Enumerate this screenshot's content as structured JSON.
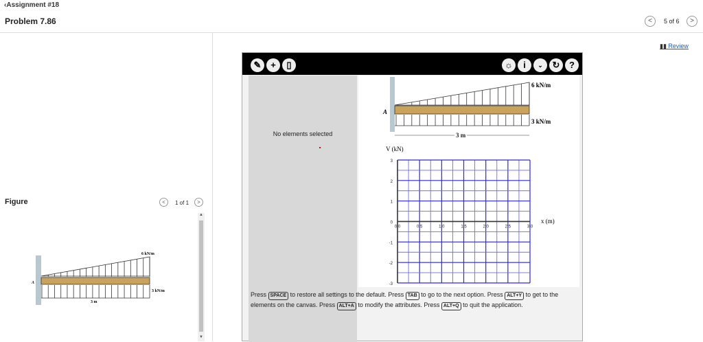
{
  "header": {
    "back_label": "Assignment #18",
    "problem_title": "Problem 7.86",
    "pager": "5 of 6",
    "prev": "<",
    "next": ">"
  },
  "review": {
    "label": "Review"
  },
  "figure": {
    "title": "Figure",
    "pager": "1 of 1",
    "prev": "<",
    "next": ">",
    "load_top": "6 kN/m",
    "load_bottom": "3 kN/m",
    "length": "3 m",
    "support": "A"
  },
  "app": {
    "toolbar_left": [
      "pencil-icon",
      "plus-icon",
      "trash-icon"
    ],
    "toolbar_right": [
      "hint-icon",
      "info-icon",
      "chevron-down-icon",
      "reset-icon",
      "help-icon"
    ],
    "status": "No elements selected",
    "diagram": {
      "load_top": "6 kN/m",
      "load_bottom": "3 kN/m",
      "length": "3 m",
      "support": "A"
    },
    "help": {
      "p1": "Press",
      "k1": "SPACE",
      "p2": "to restore all settings to the default. Press",
      "k2": "TAB",
      "p3": "to go to the next option. Press",
      "k3": "ALT+Y",
      "p4": "to get to the elements on the canvas. Press",
      "k4": "ALT+A",
      "p5": "to modify the attributes. Press",
      "k5": "ALT+Q",
      "p6": "to quit the application."
    }
  },
  "chart_data": {
    "type": "line",
    "title": "",
    "xlabel": "x (m)",
    "ylabel": "V (kN)",
    "xlim": [
      0,
      3
    ],
    "ylim": [
      -3,
      3
    ],
    "xticks": [
      "0.0",
      "0.5",
      "1.0",
      "1.5",
      "2.0",
      "2.5",
      "3.0"
    ],
    "yticks": [
      "3",
      "2",
      "1",
      "0",
      "-1",
      "-2",
      "-3"
    ],
    "grid": true,
    "x_minor_step": 0.25,
    "y_minor_step": 0.5,
    "series": []
  }
}
